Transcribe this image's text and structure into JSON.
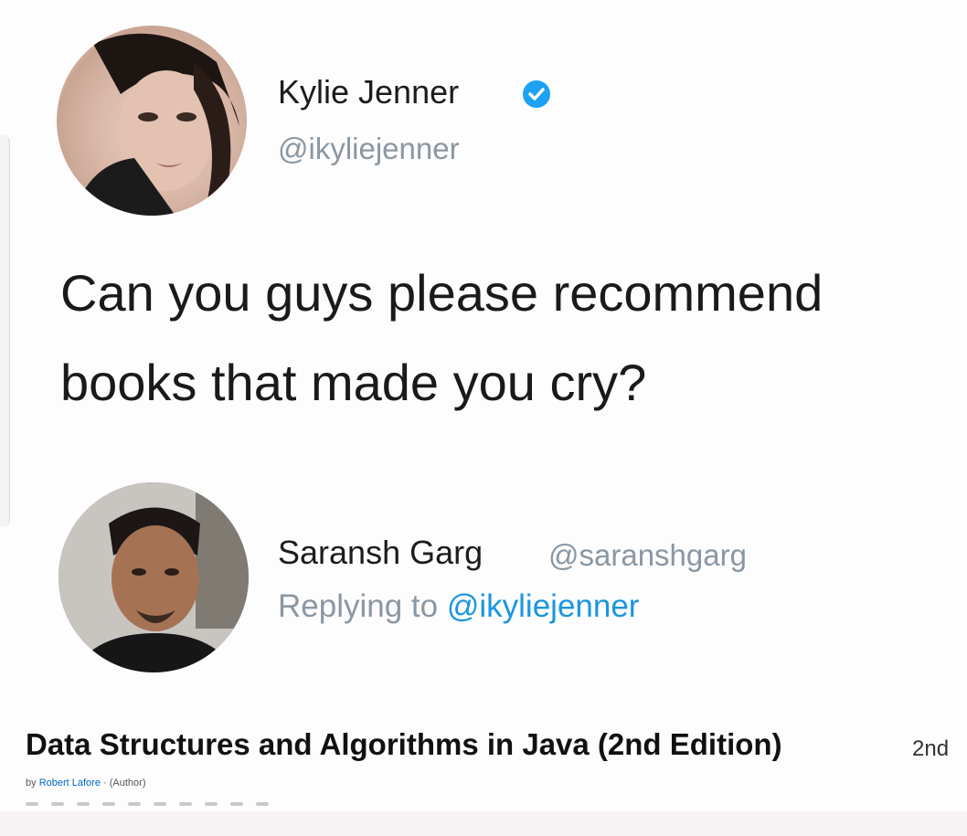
{
  "original_tweet": {
    "display_name": "Kylie Jenner",
    "handle": "@ikyliejenner",
    "verified": true,
    "text_line1": "Can you guys please recommend",
    "text_line2": "books that made you cry?",
    "avatar_icon": "profile-photo"
  },
  "reply": {
    "display_name": "Saransh Garg",
    "handle": "@saranshgarg",
    "replying_prefix": "Replying to",
    "replying_to": "@ikyliejenner",
    "avatar_icon": "profile-photo"
  },
  "book": {
    "title": "Data Structures and Algorithms in Java (2nd Edition)",
    "edition": "2nd",
    "byline_prefix": "by",
    "author": "Robert Lafore",
    "role": "(Author)"
  },
  "colors": {
    "link_blue": "#1b95e0",
    "muted_gray": "#8a97a3",
    "verified_blue": "#1da1f2"
  }
}
